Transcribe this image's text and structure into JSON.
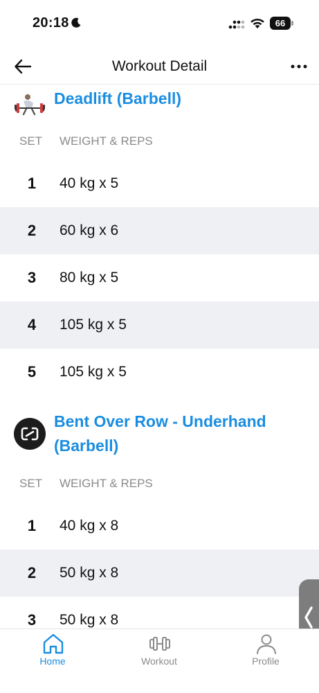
{
  "status_bar": {
    "time": "20:18",
    "battery": "66",
    "icons": [
      "moon-icon",
      "signal-icon",
      "wifi-icon",
      "battery-icon"
    ]
  },
  "nav": {
    "title": "Workout Detail",
    "back_icon": "arrow-left-icon",
    "more_icon": "more-horizontal-icon"
  },
  "exercises": [
    {
      "title": "Deadlift (Barbell)",
      "thumb": "deadlift-illustration",
      "col_set": "SET",
      "col_weight": "WEIGHT & REPS",
      "sets": [
        {
          "number": "1",
          "value": "40 kg x 5"
        },
        {
          "number": "2",
          "value": "60 kg x 6"
        },
        {
          "number": "3",
          "value": "80 kg x 5"
        },
        {
          "number": "4",
          "value": "105 kg x 5"
        },
        {
          "number": "5",
          "value": "105 kg x 5"
        }
      ]
    },
    {
      "title_line1": "Bent Over Row - Underhand",
      "title_line2": "(Barbell)",
      "thumb": "exercise-placeholder-icon",
      "col_set": "SET",
      "col_weight": "WEIGHT & REPS",
      "sets": [
        {
          "number": "1",
          "value": "40 kg x 8"
        },
        {
          "number": "2",
          "value": "50 kg x 8"
        },
        {
          "number": "3",
          "value": "50 kg x 8"
        }
      ]
    }
  ],
  "tabs": [
    {
      "label": "Home",
      "icon": "home-icon",
      "active": true
    },
    {
      "label": "Workout",
      "icon": "dumbbell-icon",
      "active": false
    },
    {
      "label": "Profile",
      "icon": "profile-icon",
      "active": false
    }
  ],
  "colors": {
    "accent": "#1a8de0",
    "row_alt": "#eff0f4",
    "muted_text": "#8a8a8a"
  }
}
